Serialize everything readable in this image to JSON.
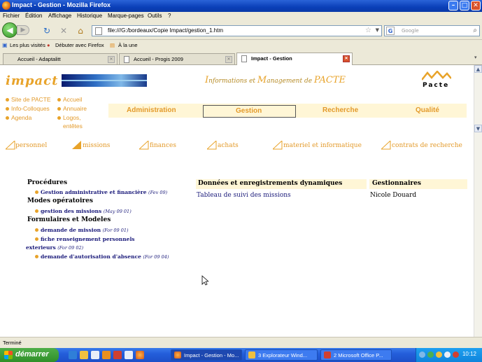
{
  "window": {
    "title": "Impact - Gestion - Mozilla Firefox",
    "controls": [
      "minimize",
      "maximize",
      "close"
    ]
  },
  "menu": [
    "Fichier",
    "Édition",
    "Affichage",
    "Historique",
    "Marque-pages",
    "Outils",
    "?"
  ],
  "navbar": {
    "back_icon": "back-arrow-icon",
    "forward_icon": "forward-arrow-icon",
    "reload_icon": "reload-icon",
    "stop_icon": "stop-icon",
    "home_icon": "home-icon",
    "url": "file:///G:/bordeaux/Copie Impact/gestion_1.htm",
    "search_placeholder": "Google"
  },
  "bookmarks": [
    "Les plus visités",
    "Débuter avec Firefox",
    "À la une"
  ],
  "tabs": [
    {
      "label": "Accueil - Adaptalitt",
      "active": false
    },
    {
      "label": "Accueil - Progis 2009",
      "active": false
    },
    {
      "label": "Impact - Gestion",
      "active": true
    }
  ],
  "page": {
    "logo": "impact",
    "headline": {
      "i": "I",
      "nformations": "nformations ",
      "et": "et ",
      "m": "M",
      "anagement": "anagement ",
      "de": "de ",
      "pacte": "PACTE"
    },
    "pacte_logo": "Pacte",
    "left_links": [
      "Site de PACTE",
      "Info-Colloques",
      "Agenda"
    ],
    "right_links": [
      "Accueil",
      "Annuaire",
      "Logos,",
      "entêtes"
    ],
    "main_nav": [
      "Administration",
      "Gestion",
      "Recherche",
      "Qualité"
    ],
    "sub_nav": [
      "personnel",
      "missions",
      "finances",
      "achats",
      "materiel et informatique",
      "contrats de recherche"
    ],
    "sections": {
      "procedures_title": "Procédures",
      "procedures_link": "Gestion administrative et financière",
      "procedures_note": "(Fev 09)",
      "modes_title": "Modes opératoires",
      "modes_link": "gestion des missions",
      "modes_note": "(May 09 01)",
      "formulaires_title": "Formulaires et Modeles",
      "form1_link": "demande de mission",
      "form1_note": "(For 09 01)",
      "form2_link_a": "fiche renseignement personnels",
      "form2_link_b": "exterieurs",
      "form2_note": "(For 09 02)",
      "form3_link": "demande d'autorisation d'absence",
      "form3_note": "(For 09 04)"
    },
    "table": {
      "col1_header": "Données et enregistrements dynamiques",
      "col2_header": "Gestionnaires",
      "col1_value": "Tableau de suivi des missions",
      "col2_value": "Nicole Douard"
    }
  },
  "status": "Terminé",
  "taskbar": {
    "start": "démarrer",
    "tasks": [
      {
        "label": "Impact - Gestion - Mo...",
        "active": true
      },
      {
        "label": "3 Explorateur Wind...",
        "active": false
      },
      {
        "label": "2 Microsoft Office P...",
        "active": false
      }
    ],
    "clock": "10:12"
  },
  "colors": {
    "accent": "#e39a2a",
    "link": "#1a1a7a",
    "nav_bg": "#fff6d6"
  }
}
